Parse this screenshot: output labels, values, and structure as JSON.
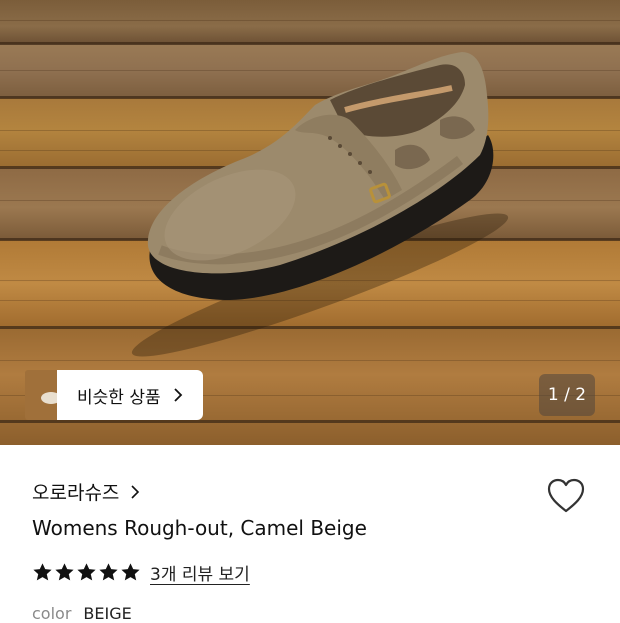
{
  "hero": {
    "similar_button_label": "비슷한 상품",
    "pager_text": "1 / 2"
  },
  "product": {
    "brand": "오로라슈즈",
    "title": "Womens Rough-out, Camel Beige",
    "rating_stars": 5,
    "rating_max": 5,
    "reviews_link": "3개 리뷰 보기",
    "color_label": "color",
    "color_value": "BEIGE"
  },
  "icons": {
    "brand_chevron": "chevron-right-icon",
    "similar_chevron": "chevron-right-icon",
    "wishlist": "heart-outline-icon",
    "star": "star-filled-icon"
  },
  "colors": {
    "star": "#111111",
    "text_primary": "#111111",
    "text_muted": "#8a8a8a"
  }
}
